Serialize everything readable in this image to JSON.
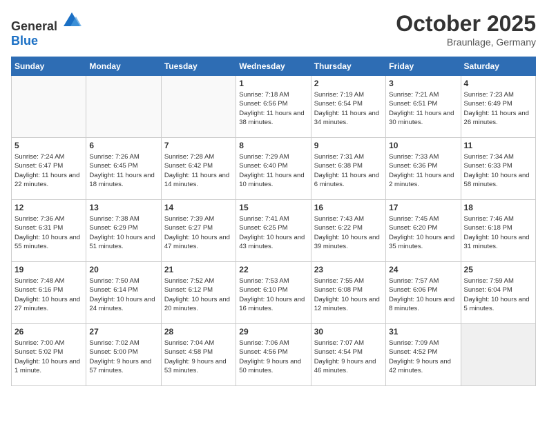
{
  "header": {
    "logo_general": "General",
    "logo_blue": "Blue",
    "title": "October 2025",
    "subtitle": "Braunlage, Germany"
  },
  "weekdays": [
    "Sunday",
    "Monday",
    "Tuesday",
    "Wednesday",
    "Thursday",
    "Friday",
    "Saturday"
  ],
  "weeks": [
    [
      {
        "day": "",
        "info": ""
      },
      {
        "day": "",
        "info": ""
      },
      {
        "day": "",
        "info": ""
      },
      {
        "day": "1",
        "info": "Sunrise: 7:18 AM\nSunset: 6:56 PM\nDaylight: 11 hours and 38 minutes."
      },
      {
        "day": "2",
        "info": "Sunrise: 7:19 AM\nSunset: 6:54 PM\nDaylight: 11 hours and 34 minutes."
      },
      {
        "day": "3",
        "info": "Sunrise: 7:21 AM\nSunset: 6:51 PM\nDaylight: 11 hours and 30 minutes."
      },
      {
        "day": "4",
        "info": "Sunrise: 7:23 AM\nSunset: 6:49 PM\nDaylight: 11 hours and 26 minutes."
      }
    ],
    [
      {
        "day": "5",
        "info": "Sunrise: 7:24 AM\nSunset: 6:47 PM\nDaylight: 11 hours and 22 minutes."
      },
      {
        "day": "6",
        "info": "Sunrise: 7:26 AM\nSunset: 6:45 PM\nDaylight: 11 hours and 18 minutes."
      },
      {
        "day": "7",
        "info": "Sunrise: 7:28 AM\nSunset: 6:42 PM\nDaylight: 11 hours and 14 minutes."
      },
      {
        "day": "8",
        "info": "Sunrise: 7:29 AM\nSunset: 6:40 PM\nDaylight: 11 hours and 10 minutes."
      },
      {
        "day": "9",
        "info": "Sunrise: 7:31 AM\nSunset: 6:38 PM\nDaylight: 11 hours and 6 minutes."
      },
      {
        "day": "10",
        "info": "Sunrise: 7:33 AM\nSunset: 6:36 PM\nDaylight: 11 hours and 2 minutes."
      },
      {
        "day": "11",
        "info": "Sunrise: 7:34 AM\nSunset: 6:33 PM\nDaylight: 10 hours and 58 minutes."
      }
    ],
    [
      {
        "day": "12",
        "info": "Sunrise: 7:36 AM\nSunset: 6:31 PM\nDaylight: 10 hours and 55 minutes."
      },
      {
        "day": "13",
        "info": "Sunrise: 7:38 AM\nSunset: 6:29 PM\nDaylight: 10 hours and 51 minutes."
      },
      {
        "day": "14",
        "info": "Sunrise: 7:39 AM\nSunset: 6:27 PM\nDaylight: 10 hours and 47 minutes."
      },
      {
        "day": "15",
        "info": "Sunrise: 7:41 AM\nSunset: 6:25 PM\nDaylight: 10 hours and 43 minutes."
      },
      {
        "day": "16",
        "info": "Sunrise: 7:43 AM\nSunset: 6:22 PM\nDaylight: 10 hours and 39 minutes."
      },
      {
        "day": "17",
        "info": "Sunrise: 7:45 AM\nSunset: 6:20 PM\nDaylight: 10 hours and 35 minutes."
      },
      {
        "day": "18",
        "info": "Sunrise: 7:46 AM\nSunset: 6:18 PM\nDaylight: 10 hours and 31 minutes."
      }
    ],
    [
      {
        "day": "19",
        "info": "Sunrise: 7:48 AM\nSunset: 6:16 PM\nDaylight: 10 hours and 27 minutes."
      },
      {
        "day": "20",
        "info": "Sunrise: 7:50 AM\nSunset: 6:14 PM\nDaylight: 10 hours and 24 minutes."
      },
      {
        "day": "21",
        "info": "Sunrise: 7:52 AM\nSunset: 6:12 PM\nDaylight: 10 hours and 20 minutes."
      },
      {
        "day": "22",
        "info": "Sunrise: 7:53 AM\nSunset: 6:10 PM\nDaylight: 10 hours and 16 minutes."
      },
      {
        "day": "23",
        "info": "Sunrise: 7:55 AM\nSunset: 6:08 PM\nDaylight: 10 hours and 12 minutes."
      },
      {
        "day": "24",
        "info": "Sunrise: 7:57 AM\nSunset: 6:06 PM\nDaylight: 10 hours and 8 minutes."
      },
      {
        "day": "25",
        "info": "Sunrise: 7:59 AM\nSunset: 6:04 PM\nDaylight: 10 hours and 5 minutes."
      }
    ],
    [
      {
        "day": "26",
        "info": "Sunrise: 7:00 AM\nSunset: 5:02 PM\nDaylight: 10 hours and 1 minute."
      },
      {
        "day": "27",
        "info": "Sunrise: 7:02 AM\nSunset: 5:00 PM\nDaylight: 9 hours and 57 minutes."
      },
      {
        "day": "28",
        "info": "Sunrise: 7:04 AM\nSunset: 4:58 PM\nDaylight: 9 hours and 53 minutes."
      },
      {
        "day": "29",
        "info": "Sunrise: 7:06 AM\nSunset: 4:56 PM\nDaylight: 9 hours and 50 minutes."
      },
      {
        "day": "30",
        "info": "Sunrise: 7:07 AM\nSunset: 4:54 PM\nDaylight: 9 hours and 46 minutes."
      },
      {
        "day": "31",
        "info": "Sunrise: 7:09 AM\nSunset: 4:52 PM\nDaylight: 9 hours and 42 minutes."
      },
      {
        "day": "",
        "info": ""
      }
    ]
  ]
}
